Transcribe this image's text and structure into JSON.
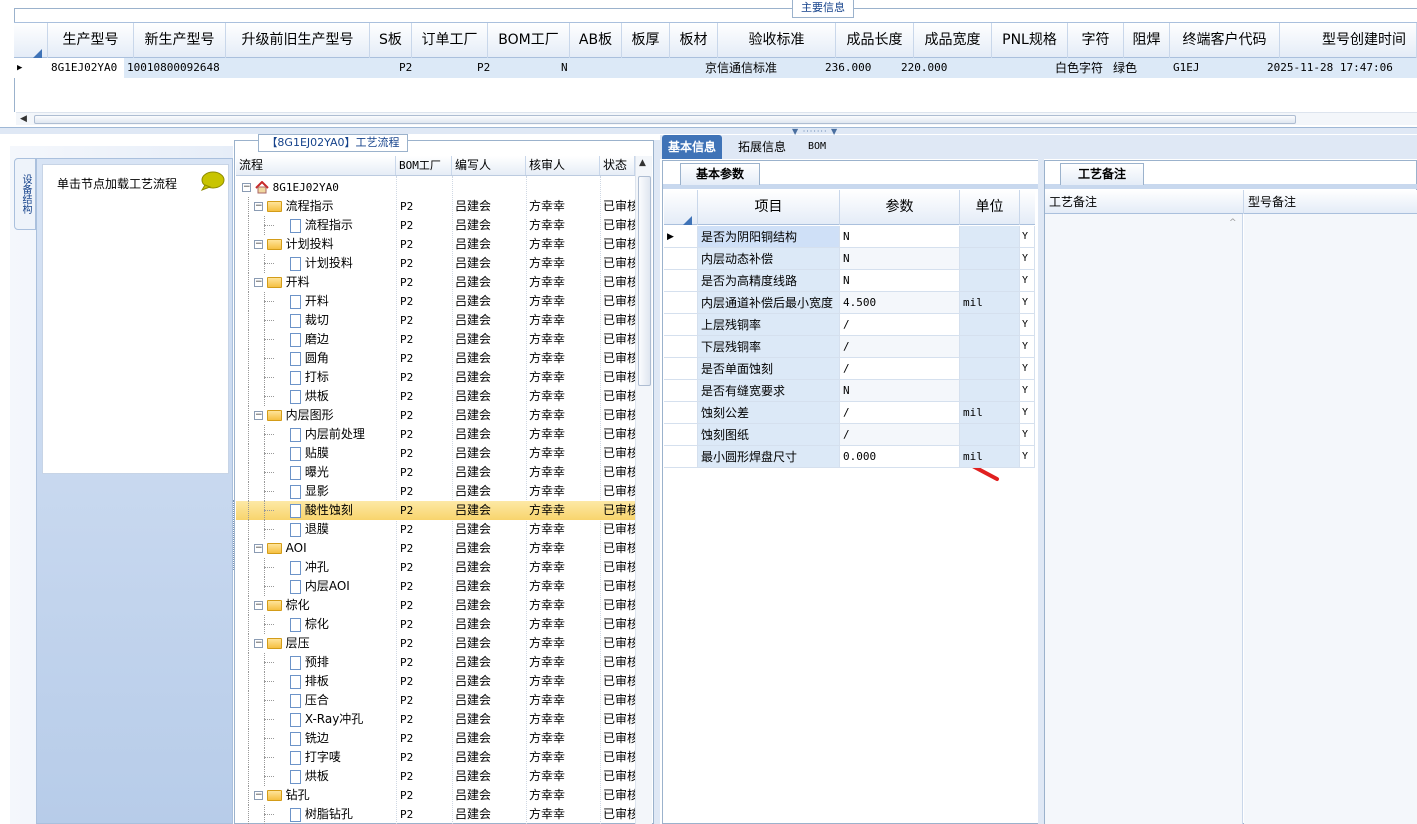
{
  "top": {
    "section_title": "主要信息",
    "columns": [
      "生产型号",
      "新生产型号",
      "升级前旧生产型号",
      "S板",
      "订单工厂",
      "BOM工厂",
      "AB板",
      "板厚",
      "板材",
      "验收标准",
      "成品长度",
      "成品宽度",
      "PNL规格",
      "字符",
      "阻焊",
      "终端客户代码",
      "型号创建时间"
    ],
    "row": {
      "prod_model": "8G1EJ02YA0",
      "new_model": "10010800092648",
      "old_model": "",
      "s_board": "",
      "order_factory": "P2",
      "bom_factory": "P2",
      "ab_board": "N",
      "thickness": "",
      "material": "",
      "standard": "京信通信标准",
      "length": "236.000",
      "width": "220.000",
      "pnl": "",
      "char": "白色字符",
      "solder": "绿色",
      "customer": "G1EJ",
      "created": "2025-11-28 17:47:06"
    }
  },
  "left": {
    "vertical_tab": "设备结构",
    "hint": "单击节点加载工艺流程"
  },
  "tree": {
    "title": "【8G1EJ02YA0】工艺流程",
    "columns": [
      "流程",
      "BOM工厂",
      "编写人",
      "核审人",
      "状态"
    ],
    "root_label": "8G1EJ02YA0",
    "rows": [
      {
        "label": "流程指示",
        "level": 1,
        "folder": true,
        "bom": "P2",
        "writer": "吕建会",
        "reviewer": "方幸幸",
        "status": "已审核"
      },
      {
        "label": "流程指示",
        "level": 2,
        "folder": false,
        "bom": "P2",
        "writer": "吕建会",
        "reviewer": "方幸幸",
        "status": "已审核"
      },
      {
        "label": "计划投料",
        "level": 1,
        "folder": true,
        "bom": "P2",
        "writer": "吕建会",
        "reviewer": "方幸幸",
        "status": "已审核"
      },
      {
        "label": "计划投料",
        "level": 2,
        "folder": false,
        "bom": "P2",
        "writer": "吕建会",
        "reviewer": "方幸幸",
        "status": "已审核"
      },
      {
        "label": "开料",
        "level": 1,
        "folder": true,
        "bom": "P2",
        "writer": "吕建会",
        "reviewer": "方幸幸",
        "status": "已审核"
      },
      {
        "label": "开料",
        "level": 2,
        "folder": false,
        "bom": "P2",
        "writer": "吕建会",
        "reviewer": "方幸幸",
        "status": "已审核"
      },
      {
        "label": "裁切",
        "level": 2,
        "folder": false,
        "bom": "P2",
        "writer": "吕建会",
        "reviewer": "方幸幸",
        "status": "已审核"
      },
      {
        "label": "磨边",
        "level": 2,
        "folder": false,
        "bom": "P2",
        "writer": "吕建会",
        "reviewer": "方幸幸",
        "status": "已审核"
      },
      {
        "label": "圆角",
        "level": 2,
        "folder": false,
        "bom": "P2",
        "writer": "吕建会",
        "reviewer": "方幸幸",
        "status": "已审核"
      },
      {
        "label": "打标",
        "level": 2,
        "folder": false,
        "bom": "P2",
        "writer": "吕建会",
        "reviewer": "方幸幸",
        "status": "已审核"
      },
      {
        "label": "烘板",
        "level": 2,
        "folder": false,
        "bom": "P2",
        "writer": "吕建会",
        "reviewer": "方幸幸",
        "status": "已审核"
      },
      {
        "label": "内层图形",
        "level": 1,
        "folder": true,
        "bom": "P2",
        "writer": "吕建会",
        "reviewer": "方幸幸",
        "status": "已审核"
      },
      {
        "label": "内层前处理",
        "level": 2,
        "folder": false,
        "bom": "P2",
        "writer": "吕建会",
        "reviewer": "方幸幸",
        "status": "已审核"
      },
      {
        "label": "贴膜",
        "level": 2,
        "folder": false,
        "bom": "P2",
        "writer": "吕建会",
        "reviewer": "方幸幸",
        "status": "已审核"
      },
      {
        "label": "曝光",
        "level": 2,
        "folder": false,
        "bom": "P2",
        "writer": "吕建会",
        "reviewer": "方幸幸",
        "status": "已审核"
      },
      {
        "label": "显影",
        "level": 2,
        "folder": false,
        "bom": "P2",
        "writer": "吕建会",
        "reviewer": "方幸幸",
        "status": "已审核"
      },
      {
        "label": "酸性蚀刻",
        "level": 2,
        "folder": false,
        "bom": "P2",
        "writer": "吕建会",
        "reviewer": "方幸幸",
        "status": "已审核",
        "selected": true
      },
      {
        "label": "退膜",
        "level": 2,
        "folder": false,
        "bom": "P2",
        "writer": "吕建会",
        "reviewer": "方幸幸",
        "status": "已审核"
      },
      {
        "label": "AOI",
        "level": 1,
        "folder": true,
        "bom": "P2",
        "writer": "吕建会",
        "reviewer": "方幸幸",
        "status": "已审核"
      },
      {
        "label": "冲孔",
        "level": 2,
        "folder": false,
        "bom": "P2",
        "writer": "吕建会",
        "reviewer": "方幸幸",
        "status": "已审核"
      },
      {
        "label": "内层AOI",
        "level": 2,
        "folder": false,
        "bom": "P2",
        "writer": "吕建会",
        "reviewer": "方幸幸",
        "status": "已审核"
      },
      {
        "label": "棕化",
        "level": 1,
        "folder": true,
        "bom": "P2",
        "writer": "吕建会",
        "reviewer": "方幸幸",
        "status": "已审核"
      },
      {
        "label": "棕化",
        "level": 2,
        "folder": false,
        "bom": "P2",
        "writer": "吕建会",
        "reviewer": "方幸幸",
        "status": "已审核"
      },
      {
        "label": "层压",
        "level": 1,
        "folder": true,
        "bom": "P2",
        "writer": "吕建会",
        "reviewer": "方幸幸",
        "status": "已审核"
      },
      {
        "label": "预排",
        "level": 2,
        "folder": false,
        "bom": "P2",
        "writer": "吕建会",
        "reviewer": "方幸幸",
        "status": "已审核"
      },
      {
        "label": "排板",
        "level": 2,
        "folder": false,
        "bom": "P2",
        "writer": "吕建会",
        "reviewer": "方幸幸",
        "status": "已审核"
      },
      {
        "label": "压合",
        "level": 2,
        "folder": false,
        "bom": "P2",
        "writer": "吕建会",
        "reviewer": "方幸幸",
        "status": "已审核"
      },
      {
        "label": "X-Ray冲孔",
        "level": 2,
        "folder": false,
        "bom": "P2",
        "writer": "吕建会",
        "reviewer": "方幸幸",
        "status": "已审核"
      },
      {
        "label": "铣边",
        "level": 2,
        "folder": false,
        "bom": "P2",
        "writer": "吕建会",
        "reviewer": "方幸幸",
        "status": "已审核"
      },
      {
        "label": "打字唛",
        "level": 2,
        "folder": false,
        "bom": "P2",
        "writer": "吕建会",
        "reviewer": "方幸幸",
        "status": "已审核"
      },
      {
        "label": "烘板",
        "level": 2,
        "folder": false,
        "bom": "P2",
        "writer": "吕建会",
        "reviewer": "方幸幸",
        "status": "已审核"
      },
      {
        "label": "钻孔",
        "level": 1,
        "folder": true,
        "bom": "P2",
        "writer": "吕建会",
        "reviewer": "方幸幸",
        "status": "已审核"
      },
      {
        "label": "树脂钻孔",
        "level": 2,
        "folder": false,
        "bom": "P2",
        "writer": "吕建会",
        "reviewer": "方幸幸",
        "status": "已审核"
      }
    ]
  },
  "detail": {
    "tabs": [
      "基本信息",
      "拓展信息",
      "BOM"
    ],
    "params_tab": "基本参数",
    "params_columns": [
      "项目",
      "参数",
      "单位"
    ],
    "params": [
      {
        "item": "是否为阴阳铜结构",
        "value": "N",
        "unit": "",
        "flag": "Y"
      },
      {
        "item": "内层动态补偿",
        "value": "N",
        "unit": "",
        "flag": "Y"
      },
      {
        "item": "是否为高精度线路",
        "value": "N",
        "unit": "",
        "flag": "Y"
      },
      {
        "item": "内层通道补偿后最小宽度",
        "value": "4.500",
        "unit": "mil",
        "flag": "Y"
      },
      {
        "item": "上层残铜率",
        "value": "/",
        "unit": "",
        "flag": "Y"
      },
      {
        "item": "下层残铜率",
        "value": "/",
        "unit": "",
        "flag": "Y"
      },
      {
        "item": "是否单面蚀刻",
        "value": "/",
        "unit": "",
        "flag": "Y"
      },
      {
        "item": "是否有缝宽要求",
        "value": "N",
        "unit": "",
        "flag": "Y"
      },
      {
        "item": "蚀刻公差",
        "value": "/",
        "unit": "mil",
        "flag": "Y"
      },
      {
        "item": "蚀刻图纸",
        "value": "/",
        "unit": "",
        "flag": "Y"
      },
      {
        "item": "最小圆形焊盘尺寸",
        "value": "0.000",
        "unit": "mil",
        "flag": "Y"
      }
    ],
    "notes_tab": "工艺备注",
    "notes_columns": [
      "工艺备注",
      "型号备注"
    ]
  },
  "colors": {
    "accent": "#3f73b7",
    "selected_row": "#f8d46c",
    "arrow": "#e02020"
  }
}
